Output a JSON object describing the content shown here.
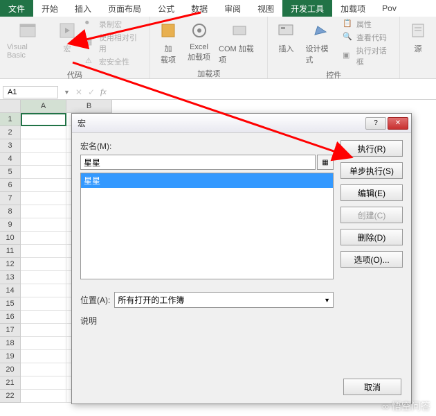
{
  "ribbon": {
    "tabs": {
      "file": "文件",
      "home": "开始",
      "insert": "插入",
      "layout": "页面布局",
      "formula": "公式",
      "data": "数据",
      "review": "审阅",
      "view": "视图",
      "developer": "开发工具",
      "addins": "加载项",
      "pow": "Pov"
    },
    "code_group": {
      "visual_basic": "Visual Basic",
      "macro": "宏",
      "record": "录制宏",
      "relative": "使用相对引用",
      "security": "宏安全性",
      "label": "代码"
    },
    "addins_group": {
      "addins": "加\n载项",
      "excel_addins": "Excel\n加载项",
      "com_addins": "COM 加载项",
      "label": "加载项"
    },
    "controls_group": {
      "insert": "插入",
      "design": "设计模式",
      "properties": "属性",
      "view_code": "查看代码",
      "run_dialog": "执行对话框",
      "label": "控件"
    },
    "source_group": {
      "source": "源"
    }
  },
  "formula_bar": {
    "name_box": "A1",
    "fx": "fx"
  },
  "grid": {
    "columns": [
      "A",
      "B"
    ],
    "rows": [
      "1",
      "2",
      "3",
      "4",
      "5",
      "6",
      "7",
      "8",
      "9",
      "10",
      "11",
      "12",
      "13",
      "14",
      "15",
      "16",
      "17",
      "18",
      "19",
      "20",
      "21",
      "22"
    ]
  },
  "dialog": {
    "title": "宏",
    "macro_name_label": "宏名(M):",
    "macro_name_value": "星星",
    "list_items": [
      "星星"
    ],
    "location_label": "位置(A):",
    "location_value": "所有打开的工作簿",
    "desc_label": "说明",
    "buttons": {
      "run": "执行(R)",
      "step": "单步执行(S)",
      "edit": "编辑(E)",
      "create": "创建(C)",
      "delete": "删除(D)",
      "options": "选项(O)...",
      "cancel": "取消"
    },
    "help_icon": "?",
    "close_icon": "✕"
  },
  "watermark": "悟空问答"
}
